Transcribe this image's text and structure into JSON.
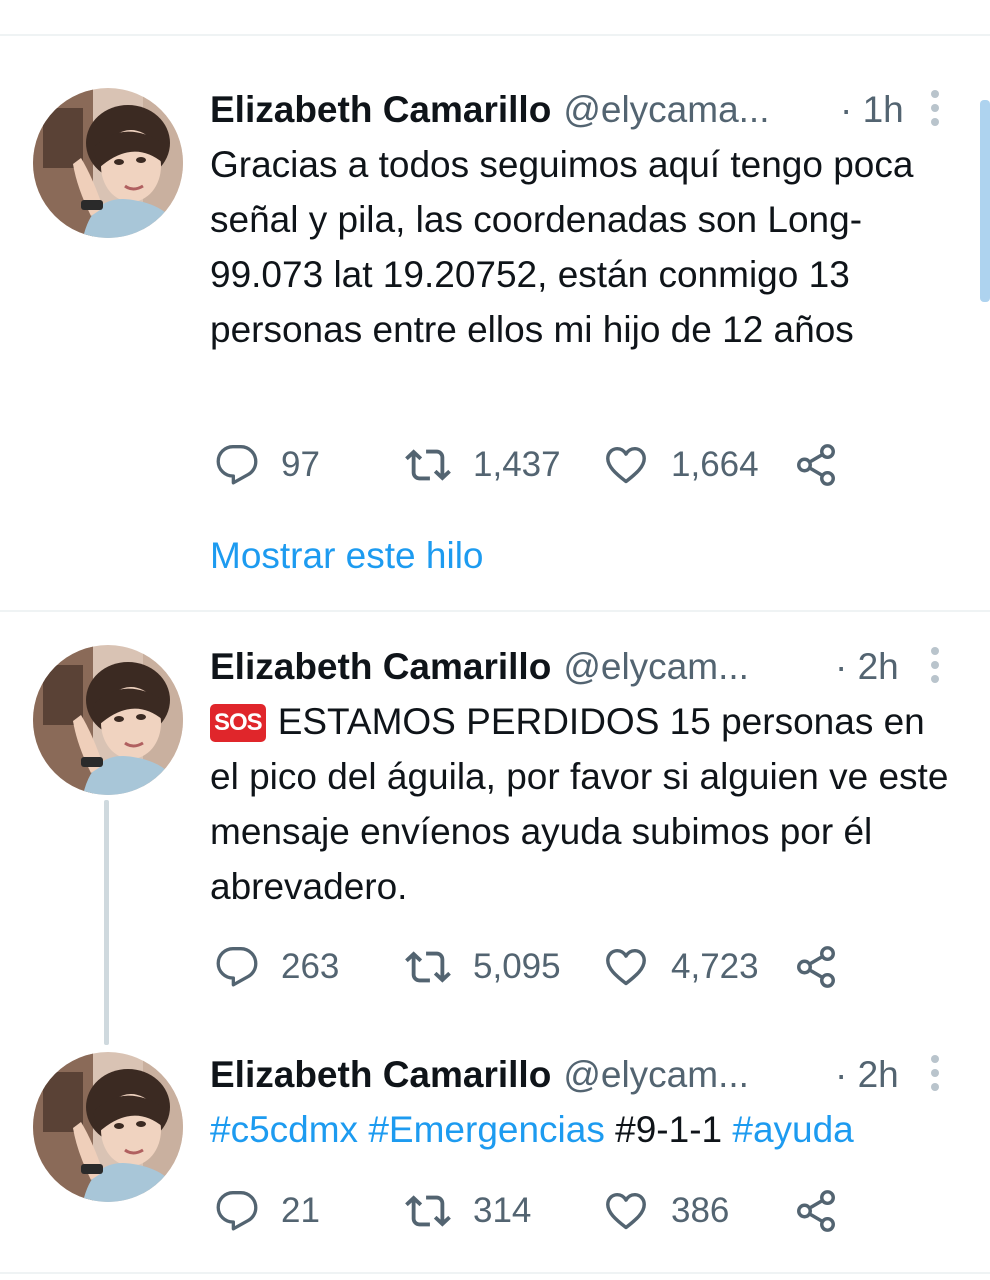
{
  "tweets": [
    {
      "name": "Elizabeth Camarillo",
      "handle": "@elycama...",
      "time": "· 1h",
      "text": "Gracias a todos seguimos aquí tengo poca señal y pila, las coordenadas son Long-99.073 lat 19.20752, están conmigo 13 personas entre ellos mi hijo de 12 años",
      "replies": "97",
      "retweets": "1,437",
      "likes": "1,664",
      "show_thread": "Mostrar este hilo"
    },
    {
      "name": "Elizabeth Camarillo",
      "handle": "@elycam...",
      "time": "· 2h",
      "emoji": "SOS",
      "text": "ESTAMOS PERDIDOS 15 personas en el pico del águila, por favor si alguien ve este mensaje envíenos ayuda subimos por él abrevadero.",
      "replies": "263",
      "retweets": "5,095",
      "likes": "4,723"
    },
    {
      "name": "Elizabeth Camarillo",
      "handle": "@elycam...",
      "time": "· 2h",
      "tags": [
        "#c5cdmx",
        "#Emergencias",
        "#9-1-1",
        "#ayuda"
      ],
      "replies": "21",
      "retweets": "314",
      "likes": "386"
    }
  ],
  "icons": {
    "reply": "reply-icon",
    "retweet": "retweet-icon",
    "like": "heart-icon",
    "share": "share-icon",
    "more": "more-vertical-icon"
  },
  "colors": {
    "accent": "#1d9bf0",
    "secondary_text": "#536471",
    "divider": "#eff3f4",
    "sos": "#e0262b"
  }
}
